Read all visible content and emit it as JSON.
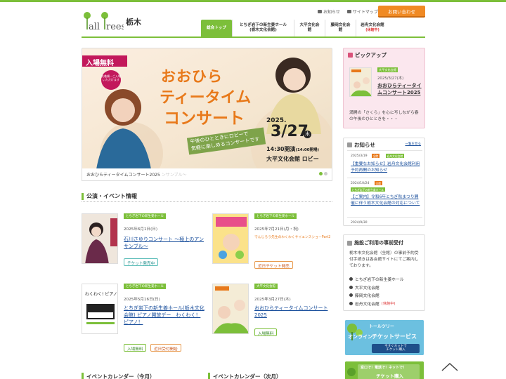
{
  "header": {
    "logo_text": "Tall Trees",
    "city": "栃木",
    "links": [
      {
        "label": "お知らせ",
        "icon": "megaphone-icon"
      },
      {
        "label": "サイトマップ",
        "icon": "sitemap-icon"
      }
    ],
    "contact_label": "お問い合わせ"
  },
  "nav": [
    {
      "label": "総合トップ",
      "active": true
    },
    {
      "label": "とちぎ岩下の新生姜ホール",
      "sub2": "(栃木文化会館)"
    },
    {
      "label": "大平文化会館"
    },
    {
      "label": "藤岡文化会館"
    },
    {
      "label": "岩舟文化会館",
      "note": "(休館中)"
    }
  ],
  "hero": {
    "ribbon": "入場無料",
    "badge": "先着順・ご入場いただけます",
    "title_line1": "おおひら",
    "title_line2": "ティータイム",
    "title_line3": "コンサート",
    "tagline1": "午後のひとときにロビーで",
    "tagline2": "気軽に楽しめるコンサートです",
    "year": "2025.",
    "date": "3/27",
    "weekday": "木",
    "time": "14:30開演",
    "doors": "(14:00開場)",
    "venue": "大平文化会館 ロビー",
    "caption": "おおひらティータイムコンサート2025",
    "caption_faded": "ンサンブル～"
  },
  "events_section": {
    "title": "公演・イベント情報",
    "items": [
      {
        "tag": "とちぎ岩下の新生姜ホール",
        "date": "2025年6月1日(日)",
        "title": "石川さゆりコンサート ～極上のアンサンブル～",
        "badges": [
          {
            "label": "チケット発売中",
            "style": "teal"
          }
        ],
        "thumb_text": "石川さゆり"
      },
      {
        "tag": "とちぎ岩下の新生姜ホール",
        "date": "2025年7月21日(月・祝)",
        "title": "でんじろう先生のわくわくサイエンスショーPart2",
        "badges": [
          {
            "label": "近日チケット発売",
            "style": "orange"
          }
        ],
        "thumb_text": "でんじろう"
      },
      {
        "tag": "とちぎ岩下の新生姜ホール",
        "date": "2025年5月16日(日)",
        "title": "とちぎ岩下の新生姜ホール(栃木文化会館) ピアノ開放デー　わくわく！ピアノ！",
        "badges": [
          {
            "label": "入場無料",
            "style": "green"
          },
          {
            "label": "近日受付開始",
            "style": "orange"
          }
        ],
        "thumb_text": "わくわく！ピアノ！"
      },
      {
        "tag": "大平文化会館",
        "date": "2025年3月27日(木)",
        "title": "おおひらティータイムコンサート2025",
        "badges": [
          {
            "label": "入場無料",
            "style": "green"
          }
        ],
        "thumb_text": "ティータイム"
      }
    ]
  },
  "calendars": [
    {
      "title": "イベントカレンダー（今月）"
    },
    {
      "title": "イベントカレンダー（次月）"
    }
  ],
  "pickup": {
    "title": "ピックアップ",
    "tag": "大平文化会館",
    "date": "2025/3/27(木)",
    "item_title": "おおひらティータイムコンサート2025",
    "desc": "満開の「さくら」を心に写しながら春の午後のひとときを・・・"
  },
  "news": {
    "title": "お知らせ",
    "more": "一覧を見る",
    "items": [
      {
        "date": "2025/3/19",
        "tags": [
          "全館",
          "岩舟文化会館"
        ],
        "text": "【重要なお知らせ】岩舟文化会館利用予約再開のお知らせ"
      },
      {
        "date": "2024/10/24",
        "tags": [
          "全館"
        ],
        "sub_tag": "とちぎ岩下の新生姜ホール",
        "text": "【ご案内】令和6年とちぎ秋まつり開催に伴う栃木文化会館の対応について"
      },
      {
        "date": "2024/9/30",
        "tags": [],
        "text": ""
      }
    ]
  },
  "reservation": {
    "title": "施設ご利用の事前受付",
    "desc": "栃木市文化会館（全館）の事前予約受付手続きは各会館サイトにてご案内しております。",
    "venues": [
      {
        "label": "とちぎ岩下の新生姜ホール"
      },
      {
        "label": "大平文化会館"
      },
      {
        "label": "藤岡文化会館"
      },
      {
        "label": "岩舟文化会館",
        "note": "(休館中)"
      }
    ]
  },
  "banners": {
    "ticket_service": {
      "brand": "トールツリー",
      "line1": "オンライン",
      "line2": "チケットサービス",
      "button1": "今すぐネットで",
      "button2": "チケット購入"
    },
    "ticket_buy": {
      "line1": "窓口で！電話で！ネットで！",
      "line2": "チケット購入"
    }
  },
  "colors": {
    "brand_green": "#7cbf3a",
    "orange": "#f08a24",
    "link_blue": "#1a4f9c"
  }
}
